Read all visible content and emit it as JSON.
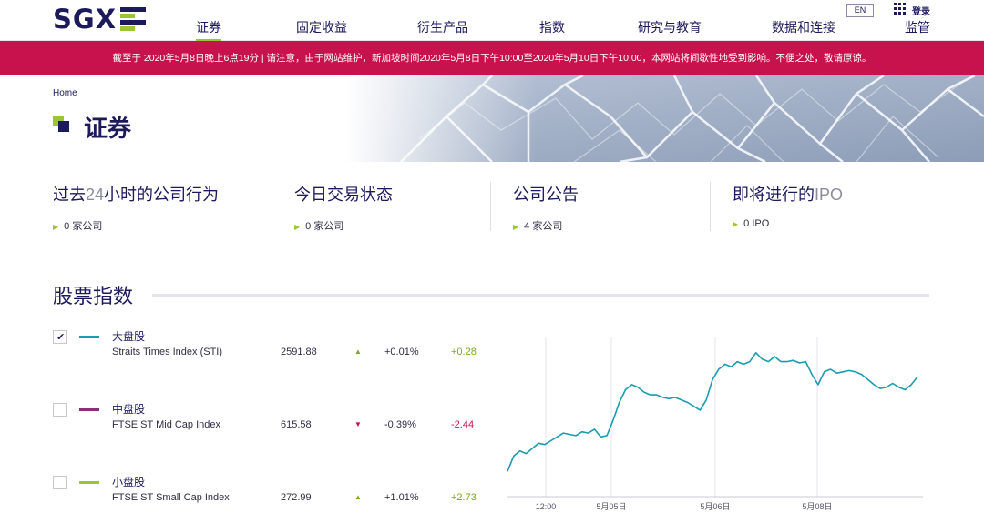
{
  "header": {
    "logo_text": "SGX",
    "nav": [
      {
        "label": "证券",
        "active": true
      },
      {
        "label": "固定收益",
        "active": false
      },
      {
        "label": "衍生产品",
        "active": false
      },
      {
        "label": "指数",
        "active": false
      },
      {
        "label": "研究与教育",
        "active": false
      },
      {
        "label": "数据和连接",
        "active": false
      },
      {
        "label": "监管",
        "active": false
      }
    ],
    "lang": "EN",
    "login": "登录"
  },
  "banner": {
    "text": "截至于 2020年5月8日晚上6点19分 | 请注意，由于网站维护，新加坡时间2020年5月8日下午10:00至2020年5月10日下午10:00，本网站将间歇性地受到影响。不便之处，敬请原谅。"
  },
  "hero": {
    "breadcrumb": "Home",
    "title": "证券"
  },
  "summary": [
    {
      "title_pre": "过去",
      "title_num": "24",
      "title_post": "小时的公司行为",
      "sub": "0 家公司"
    },
    {
      "title_pre": "今日交易状态",
      "title_num": "",
      "title_post": "",
      "sub": "0 家公司"
    },
    {
      "title_pre": "公司公告",
      "title_num": "",
      "title_post": "",
      "sub": "4 家公司"
    },
    {
      "title_pre": "即将进行的",
      "title_num": "IPO",
      "title_post": "",
      "sub": "0 IPO"
    }
  ],
  "indices": {
    "section_title": "股票指数",
    "rows": [
      {
        "name": "大盘股",
        "full": "Straits Times Index (STI)",
        "value": "2591.88",
        "pct": "+0.01%",
        "change": "+0.28",
        "direction": "up",
        "color": "#1a9bb0",
        "checked": true
      },
      {
        "name": "中盘股",
        "full": "FTSE ST Mid Cap Index",
        "value": "615.58",
        "pct": "-0.39%",
        "change": "-2.44",
        "direction": "down",
        "color": "#8a2d7e",
        "checked": false
      },
      {
        "name": "小盘股",
        "full": "FTSE ST Small Cap Index",
        "value": "272.99",
        "pct": "+1.01%",
        "change": "+2.73",
        "direction": "up",
        "color": "#9bc531",
        "checked": false
      }
    ]
  },
  "chart_data": {
    "type": "line",
    "x_tick_labels": [
      "12:00",
      "5月05日",
      "5月06日",
      "5月08日"
    ],
    "grid": true,
    "series": [
      {
        "color": "#1a9bb0",
        "values": [
          2512,
          2524,
          2528,
          2526,
          2530,
          2534,
          2533,
          2536,
          2539,
          2542,
          2541,
          2540,
          2543,
          2542,
          2545,
          2539,
          2540,
          2552,
          2566,
          2576,
          2580,
          2578,
          2574,
          2572,
          2572,
          2570,
          2569,
          2570,
          2568,
          2566,
          2563,
          2560,
          2568,
          2584,
          2592,
          2596,
          2594,
          2598,
          2596,
          2598,
          2605,
          2600,
          2598,
          2602,
          2598,
          2598,
          2599,
          2597,
          2598,
          2588,
          2580,
          2590,
          2592,
          2589,
          2590,
          2591,
          2590,
          2588,
          2584,
          2580,
          2577,
          2578,
          2581,
          2578,
          2576,
          2580,
          2586
        ]
      }
    ]
  }
}
